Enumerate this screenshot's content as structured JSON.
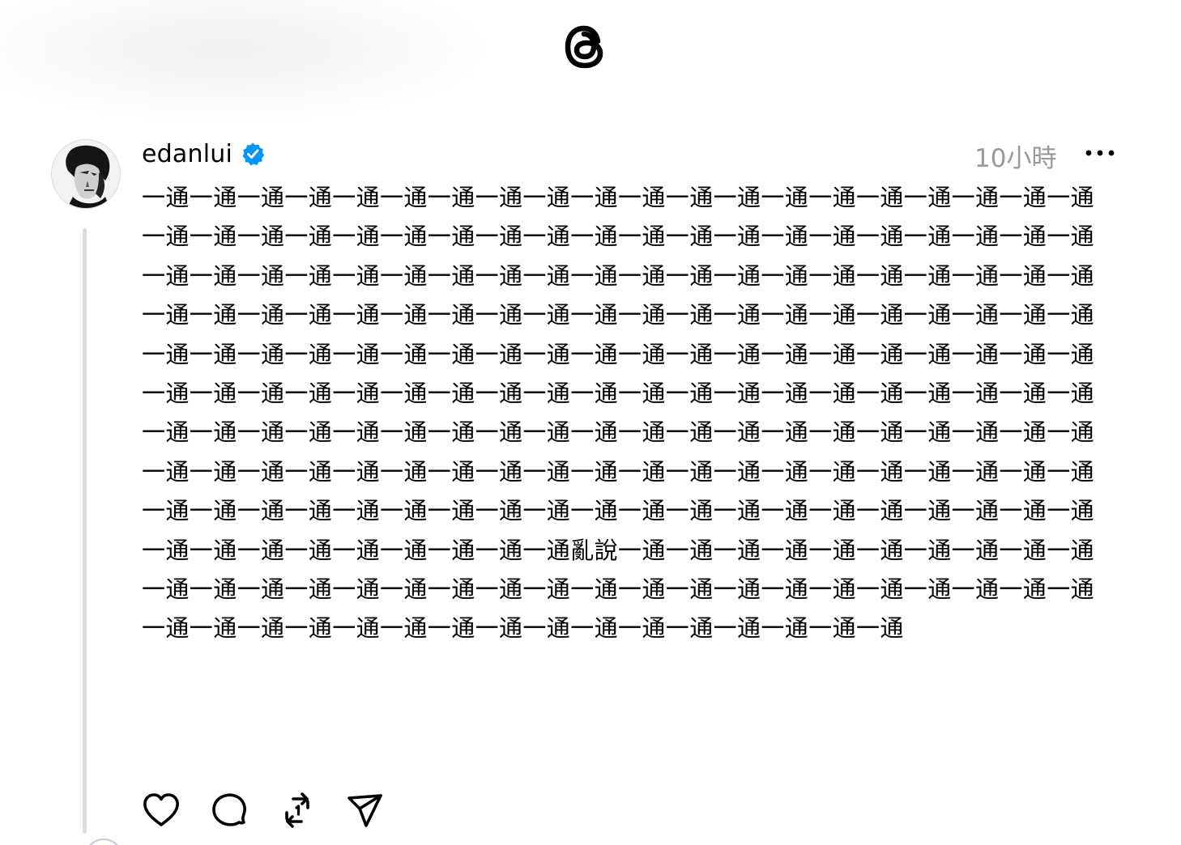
{
  "app": {
    "logo_icon": "threads-logo-icon"
  },
  "post": {
    "username": "edanlui",
    "verified_icon": "verified-badge-icon",
    "verified_color": "#0095f6",
    "timestamp": "10小時",
    "more_icon": "more-horizontal-icon",
    "text": "一通一通一通一通一通一通一通一通一通一通一通一通一通一通一通一通一通一通一通一通一通一通一通一通一通一通一通一通一通一通一通一通一通一通一通一通一通一通一通一通一通一通一通一通一通一通一通一通一通一通一通一通一通一通一通一通一通一通一通一通一通一通一通一通一通一通一通一通一通一通一通一通一通一通一通一通一通一通一通一通一通一通一通一通一通一通一通一通一通一通一通一通一通一通一通一通一通一通一通一通一通一通一通一通一通一通一通一通一通一通一通一通一通一通一通一通一通一通一通一通一通一通一通一通一通一通一通一通一通一通一通一通一通一通一通一通一通一通一通一通一通一通一通一通一通一通一通一通一通一通一通一通一通一通一通一通一通一通一通一通一通一通一通一通一通一通一通一通一通一通一通一通一通一通一通一通一通一通一通一通一通一通一通一通一通一通一通一通一通亂說一通一通一通一通一通一通一通一通一通一通一通一通一通一通一通一通一通一通一通一通一通一通一通一通一通一通一通一通一通一通一通一通一通一通一通一通一通一通一通一通一通一通一通一通一通一通"
  },
  "actions": [
    {
      "name": "like",
      "icon": "heart-icon"
    },
    {
      "name": "reply",
      "icon": "comment-icon"
    },
    {
      "name": "repost",
      "icon": "repost-icon"
    },
    {
      "name": "share",
      "icon": "send-icon"
    }
  ]
}
